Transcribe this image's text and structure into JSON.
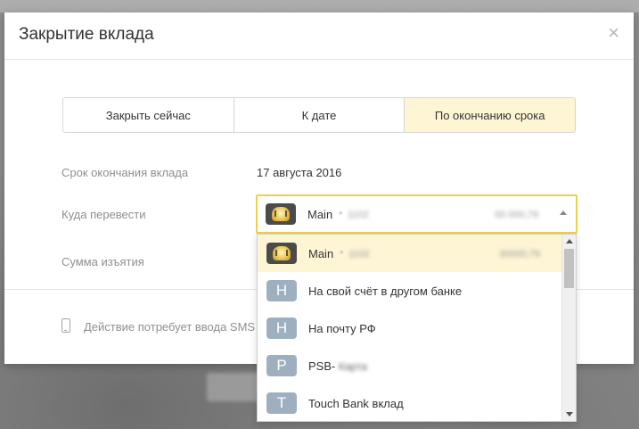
{
  "modal": {
    "title": "Закрытие вклада",
    "close_symbol": "×"
  },
  "tabs": [
    {
      "label": "Закрыть сейчас",
      "active": false
    },
    {
      "label": "К дате",
      "active": false
    },
    {
      "label": "По окончанию срока",
      "active": true
    }
  ],
  "form": {
    "end_date_label": "Срок окончания вклада",
    "end_date_value": "17 августа 2016",
    "destination_label": "Куда перевести",
    "amount_label": "Сумма изъятия"
  },
  "select": {
    "selected": {
      "name": "Main",
      "star": "*",
      "masked_number": "1102",
      "masked_balance": "00 000,79",
      "icon": "bank-emblem-icon"
    },
    "options": [
      {
        "name": "Main",
        "star": "*",
        "masked_number": "1102",
        "masked_balance": "30000,79",
        "icon": "bank-emblem-icon",
        "highlighted": true
      },
      {
        "name": "На свой счёт в другом банке",
        "letter": "Н",
        "highlighted": false
      },
      {
        "name": "На почту РФ",
        "letter": "Н",
        "highlighted": false
      },
      {
        "name": "PSB-",
        "masked_suffix": "Карта",
        "letter": "P",
        "highlighted": false
      },
      {
        "name": "Touch Bank вклад",
        "letter": "T",
        "highlighted": false
      }
    ]
  },
  "footer": {
    "sms_notice": "Действие потребует ввода SMS",
    "icon": "phone-icon"
  },
  "colors": {
    "accent_border": "#f2cf4a",
    "active_tab_bg": "#fdf5d4",
    "letter_icon_bg": "#9eb0c0"
  }
}
